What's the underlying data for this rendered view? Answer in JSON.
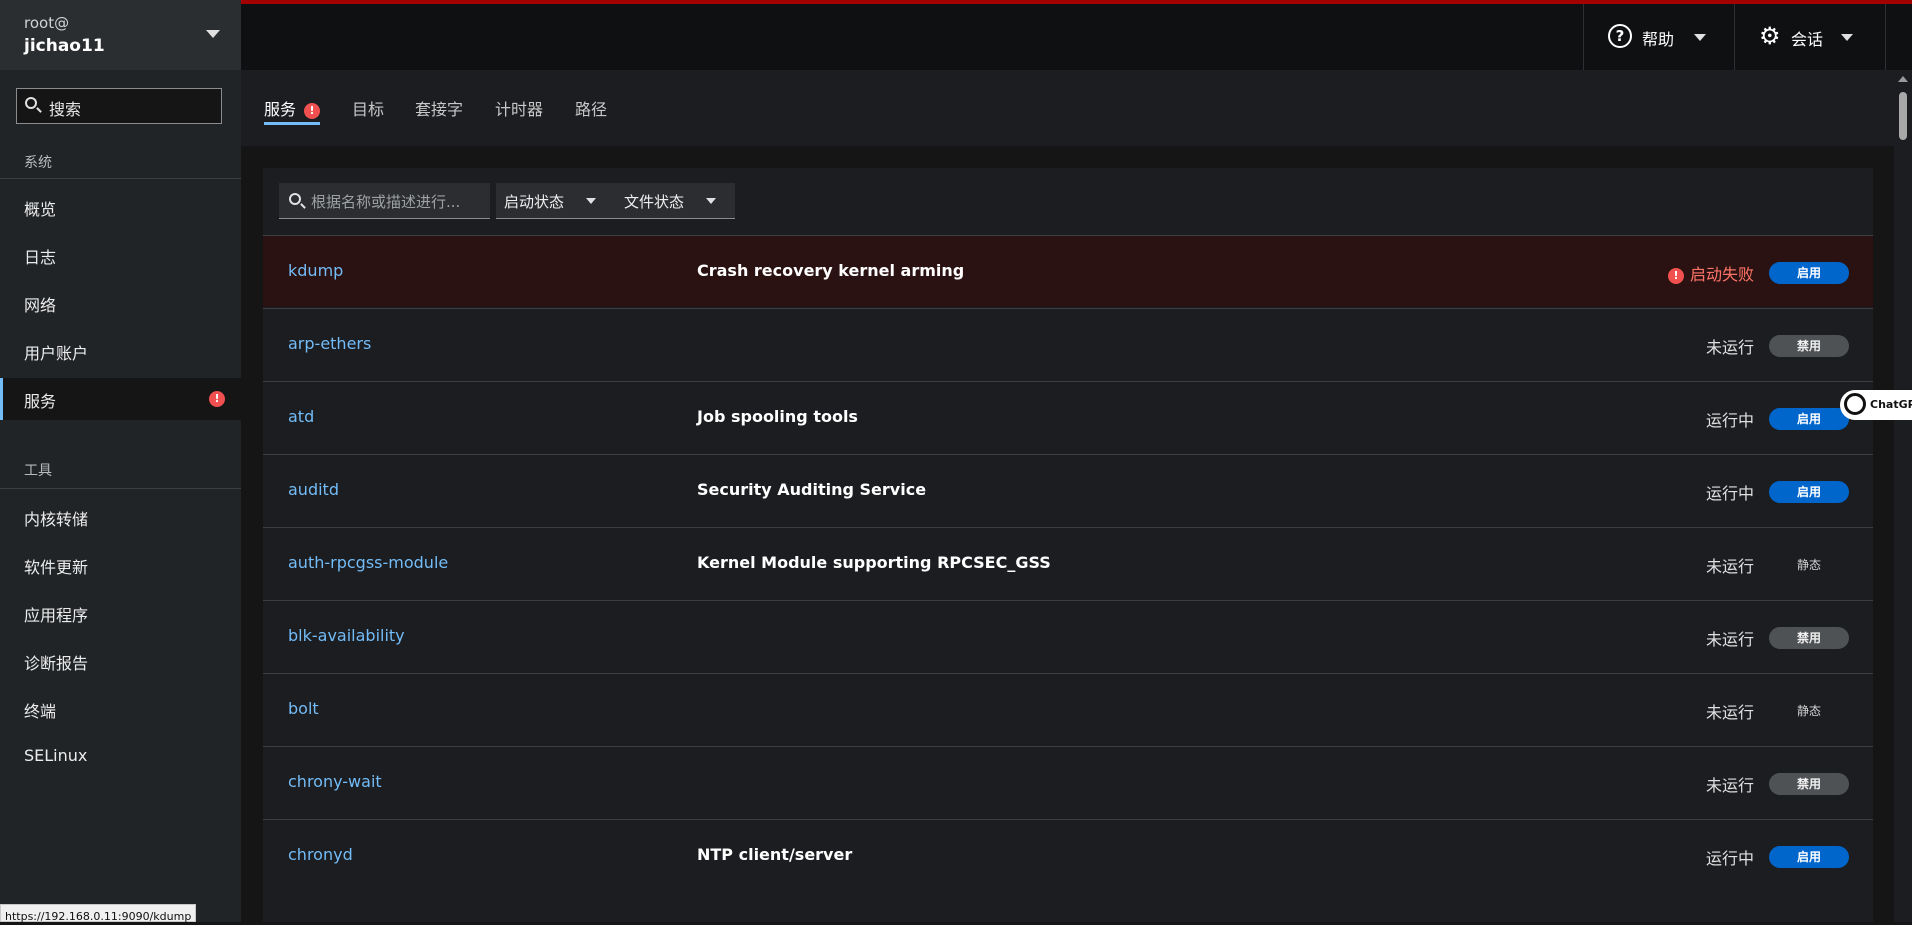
{
  "host": {
    "user": "root@",
    "name": "jichao11"
  },
  "sidebar": {
    "search_label": "搜索",
    "section_system": "系统",
    "system_items": [
      {
        "label": "概览"
      },
      {
        "label": "日志"
      },
      {
        "label": "网络"
      },
      {
        "label": "用户账户"
      },
      {
        "label": "服务",
        "error_mark": "!"
      }
    ],
    "section_tools": "工具",
    "tool_items": [
      {
        "label": "内核转储"
      },
      {
        "label": "软件更新"
      },
      {
        "label": "应用程序"
      },
      {
        "label": "诊断报告"
      },
      {
        "label": "终端"
      },
      {
        "label": "SELinux"
      }
    ]
  },
  "topbar": {
    "help_label": "帮助",
    "session_label": "会话",
    "help_glyph": "?"
  },
  "tabs": [
    {
      "label": "服务",
      "error_mark": "!"
    },
    {
      "label": "目标"
    },
    {
      "label": "套接字"
    },
    {
      "label": "计时器"
    },
    {
      "label": "路径"
    }
  ],
  "filters": {
    "search_placeholder": "根据名称或描述进行...",
    "startup_state": "启动状态",
    "file_state": "文件状态"
  },
  "services": [
    {
      "name": "kdump",
      "description": "Crash recovery kernel arming",
      "status": "启动失败",
      "state": "启用",
      "failed": true
    },
    {
      "name": "arp-ethers",
      "description": "",
      "status": "未运行",
      "state": "禁用"
    },
    {
      "name": "atd",
      "description": "Job spooling tools",
      "status": "运行中",
      "state": "启用"
    },
    {
      "name": "auditd",
      "description": "Security Auditing Service",
      "status": "运行中",
      "state": "启用"
    },
    {
      "name": "auth-rpcgss-module",
      "description": "Kernel Module supporting RPCSEC_GSS",
      "status": "未运行",
      "state": "静态"
    },
    {
      "name": "blk-availability",
      "description": "",
      "status": "未运行",
      "state": "禁用"
    },
    {
      "name": "bolt",
      "description": "",
      "status": "未运行",
      "state": "静态"
    },
    {
      "name": "chrony-wait",
      "description": "",
      "status": "未运行",
      "state": "禁用"
    },
    {
      "name": "chronyd",
      "description": "NTP client/server",
      "status": "运行中",
      "state": "启用"
    }
  ],
  "error_mark": "!",
  "chatgpt_label": "ChatGPT",
  "status_url": "https://192.168.0.11:9090/kdump",
  "colors": {
    "accent": "#73bcf7",
    "danger": "#f0504f",
    "enabled": "#0066cc",
    "disabled": "#4f5255",
    "topline": "#a30000"
  }
}
